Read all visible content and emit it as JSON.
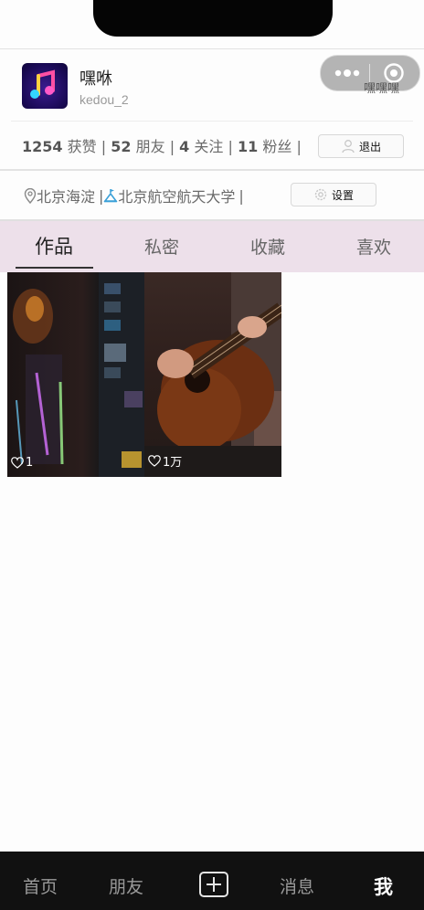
{
  "profile": {
    "name": "嘿咻",
    "id": "kedou_2"
  },
  "capsule": {
    "label": "嘿嘿嘿"
  },
  "stats": {
    "likes_count": "1254",
    "likes_label": "获赞",
    "friends_count": "52",
    "friends_label": "朋友",
    "following_count": "4",
    "following_label": "关注",
    "followers_count": "11",
    "followers_label": "粉丝",
    "sep": "|"
  },
  "buttons": {
    "logout": "退出",
    "settings": "设置"
  },
  "location": {
    "area": "北京海淀",
    "school": "北京航空航天大学",
    "sep": "|"
  },
  "tabs": [
    {
      "label": "作品",
      "active": true
    },
    {
      "label": "私密",
      "active": false
    },
    {
      "label": "收藏",
      "active": false
    },
    {
      "label": "喜欢",
      "active": false
    }
  ],
  "videos": [
    {
      "likes": "1",
      "scene": "game-screenshot"
    },
    {
      "likes": "1万",
      "scene": "guitar-player"
    }
  ],
  "bottom_nav": [
    {
      "label": "首页"
    },
    {
      "label": "朋友"
    },
    {
      "label": "add",
      "icon": "plus-square-icon"
    },
    {
      "label": "消息"
    },
    {
      "label": "我",
      "active": true
    }
  ],
  "colors": {
    "tab_bar_bg": "#ede0ea",
    "nav_bg": "#111111",
    "school_icon": "#3aa0d8"
  }
}
